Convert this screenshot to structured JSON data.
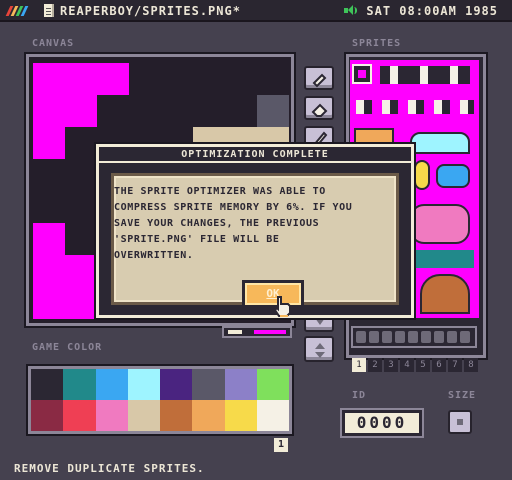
{
  "topbar": {
    "title": "REAPERBOY/SPRITES.PNG*",
    "clock": "SAT 08:00AM 1985",
    "logo_colors": [
      "#e8443a",
      "#f7b85a",
      "#3fc45a",
      "#3aa7f2"
    ]
  },
  "labels": {
    "canvas": "CANVAS",
    "sprites": "SPRITES",
    "game_color": "GAME COLOR",
    "id": "ID",
    "size": "SIZE"
  },
  "palette": {
    "colors": [
      "#2b2733",
      "#21898a",
      "#3aa7f2",
      "#9ef4ff",
      "#4a2480",
      "#5a5868",
      "#8c80c8",
      "#7fe05c",
      "#8a2a44",
      "#ef3f54",
      "#f07ac0",
      "#d8c8a8",
      "#c06e3a",
      "#f0a85a",
      "#f7da4a",
      "#f5f1e6"
    ],
    "selected_index": "1"
  },
  "pages": [
    "1",
    "2",
    "3",
    "4",
    "5",
    "6",
    "7",
    "8"
  ],
  "id_value": "0000",
  "status": "REMOVE DUPLICATE SPRITES.",
  "dialog": {
    "title": "OPTIMIZATION COMPLETE",
    "lines": [
      "THE SPRITE OPTIMIZER WAS ABLE TO",
      "COMPRESS SPRITE MEMORY BY 6%. IF YOU",
      "SAVE YOUR CHANGES, THE PREVIOUS",
      "'SPRITE.PNG' FILE WILL BE",
      "OVERWRITTEN."
    ],
    "ok_label": "OK"
  },
  "tools": [
    "brush-icon",
    "eraser-icon",
    "pencil-icon"
  ]
}
